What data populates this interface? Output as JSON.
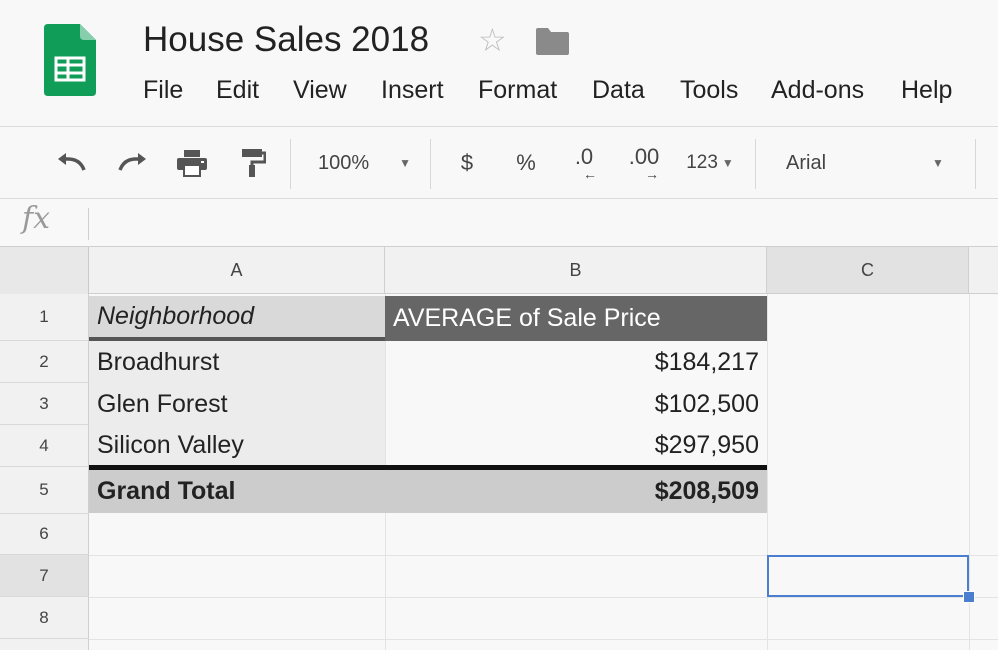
{
  "app": {
    "title": "House Sales 2018",
    "menu": [
      "File",
      "Edit",
      "View",
      "Insert",
      "Format",
      "Data",
      "Tools",
      "Add-ons",
      "Help"
    ]
  },
  "toolbar": {
    "zoom": "100%",
    "currency": "$",
    "percent": "%",
    "decrease_decimal": ".0",
    "increase_decimal": ".00",
    "more_formats": "123",
    "font": "Arial",
    "icons": [
      "undo-icon",
      "redo-icon",
      "print-icon",
      "paint-format-icon"
    ]
  },
  "formula_bar": {
    "label": "fx",
    "value": ""
  },
  "sheet": {
    "columns": [
      "A",
      "B",
      "C"
    ],
    "rows": [
      "1",
      "2",
      "3",
      "4",
      "5",
      "6",
      "7",
      "8"
    ],
    "header": {
      "a": "Neighborhood",
      "b": "AVERAGE of Sale Price"
    },
    "data": [
      {
        "a": "Broadhurst",
        "b": "$184,217"
      },
      {
        "a": "Glen Forest",
        "b": "$102,500"
      },
      {
        "a": "Silicon Valley",
        "b": "$297,950"
      }
    ],
    "total": {
      "a": "Grand Total",
      "b": "$208,509"
    },
    "selected_cell": "C7"
  },
  "colors": {
    "accent": "#0f9d58",
    "pivot_header_bg": "#666666",
    "pivot_header_label_bg": "#d9d9d9",
    "total_bg": "#cccccc",
    "selection": "#4a7fd0"
  }
}
